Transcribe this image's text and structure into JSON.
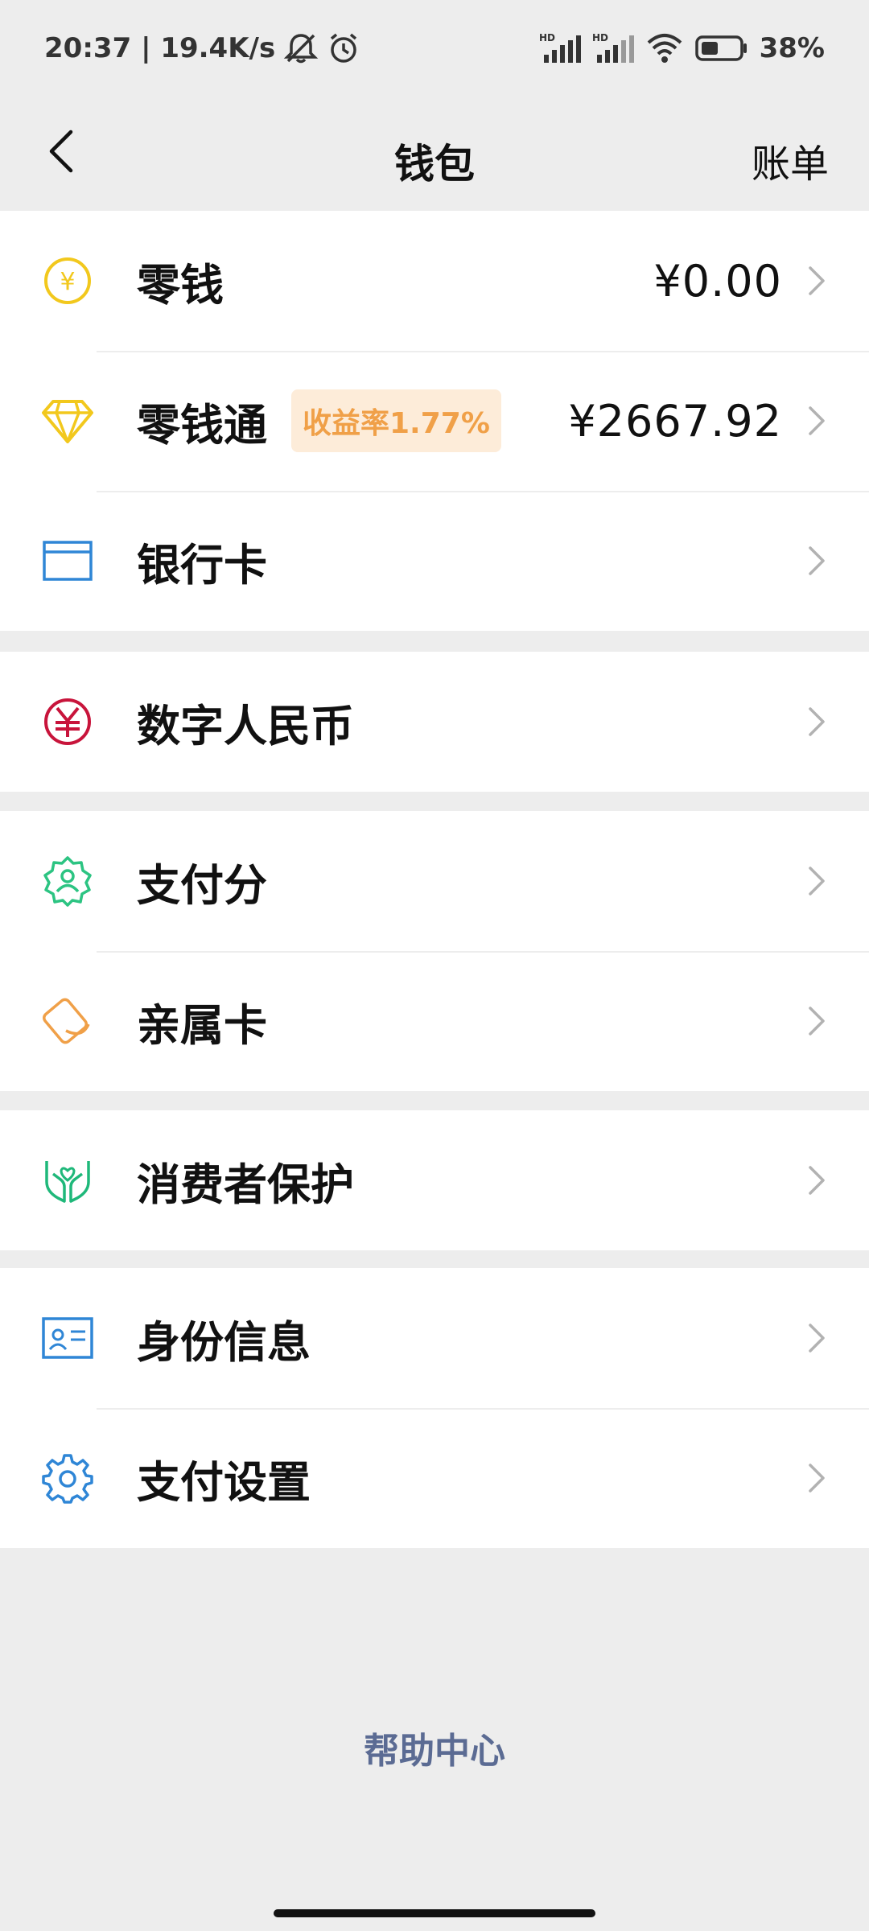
{
  "status_bar": {
    "time_speed": "20:37 | 19.4K/s",
    "battery": "38%",
    "icons": [
      "mute-bell-icon",
      "alarm-icon",
      "signal-hd-icon",
      "signal-hd-icon",
      "wifi-icon",
      "battery-icon"
    ]
  },
  "nav": {
    "title": "钱包",
    "right_label": "账单",
    "back_icon": "back-arrow-icon"
  },
  "groups": [
    {
      "items": [
        {
          "id": "change",
          "label": "零钱",
          "value": "¥0.00",
          "icon": "yuan-coin-icon",
          "color": "#f2c81d"
        },
        {
          "id": "change-plus",
          "label": "零钱通",
          "badge": "收益率1.77%",
          "value": "¥2667.92",
          "icon": "diamond-icon",
          "color": "#f2c81d"
        },
        {
          "id": "bank-card",
          "label": "银行卡",
          "icon": "bank-card-icon",
          "color": "#2f86d6"
        }
      ]
    },
    {
      "items": [
        {
          "id": "digital-rmb",
          "label": "数字人民币",
          "icon": "digital-rmb-icon",
          "color": "#c8143b"
        }
      ]
    },
    {
      "items": [
        {
          "id": "pay-score",
          "label": "支付分",
          "icon": "pay-score-icon",
          "color": "#2cc482"
        },
        {
          "id": "family-card",
          "label": "亲属卡",
          "icon": "family-card-icon",
          "color": "#f0a048"
        }
      ]
    },
    {
      "items": [
        {
          "id": "consumer-protection",
          "label": "消费者保护",
          "icon": "protect-hands-icon",
          "color": "#1fb87a"
        }
      ]
    },
    {
      "items": [
        {
          "id": "identity",
          "label": "身份信息",
          "icon": "id-card-icon",
          "color": "#2f86d6"
        },
        {
          "id": "pay-settings",
          "label": "支付设置",
          "icon": "gear-icon",
          "color": "#2f86d6"
        }
      ]
    }
  ],
  "help": {
    "label": "帮助中心"
  },
  "colors": {
    "background": "#ededed",
    "row_background": "#ffffff",
    "badge_bg": "#fdecd9",
    "badge_text": "#f0a048",
    "help_link": "#5b6b93",
    "chevron": "#b2b2b2"
  }
}
